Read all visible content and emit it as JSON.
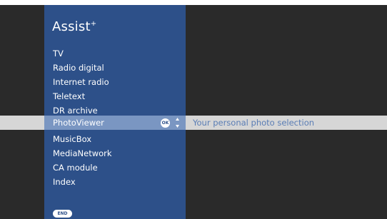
{
  "title": {
    "main": "Assist",
    "superscript": "+"
  },
  "menu": {
    "items": [
      "TV",
      "Radio digital",
      "Internet radio",
      "Teletext",
      "DR archive",
      "PhotoViewer",
      "MusicBox",
      "MediaNetwork",
      "CA module",
      "Index"
    ],
    "selected": "PhotoViewer",
    "selected_description": "Your personal photo selection"
  },
  "buttons": {
    "ok_label": "OK",
    "end_label": "END"
  },
  "icons": {
    "ok": "ok-button-icon",
    "navigate": "up-down-arrows-icon",
    "end": "end-button-icon"
  },
  "colors": {
    "background": "#2a2a2a",
    "panel": "#2d5089",
    "highlight_panel": "#7a96c2",
    "highlight_bar": "#d6d6d6",
    "description_text": "#5a7db5"
  }
}
